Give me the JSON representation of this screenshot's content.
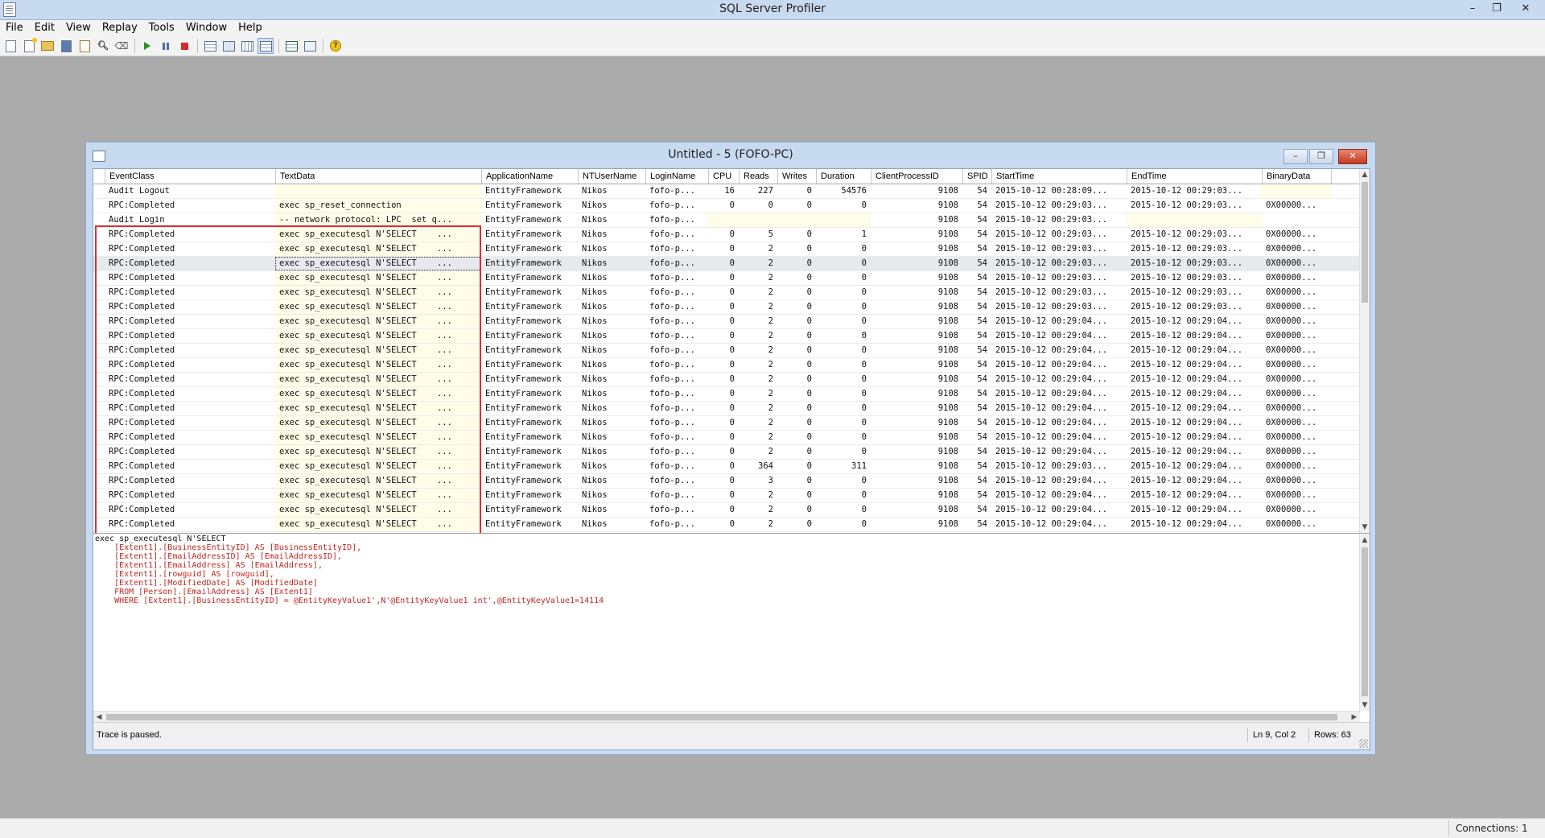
{
  "app": {
    "title": "SQL Server Profiler",
    "controls": {
      "minimize": "–",
      "restore": "❐",
      "close": "✕"
    }
  },
  "menu": [
    "File",
    "Edit",
    "View",
    "Replay",
    "Tools",
    "Window",
    "Help"
  ],
  "toolbar": {
    "icons": [
      "new-trace-icon",
      "new-template-icon",
      "open-icon",
      "save-icon",
      "properties-icon",
      "find-icon",
      "clear-icon",
      "start-icon",
      "pause-icon",
      "stop-icon",
      "sql-window-icon",
      "auto-scroll-icon",
      "columns-icon",
      "events-icon",
      "replay-icon",
      "monitor-icon",
      "help-icon"
    ]
  },
  "window": {
    "title": "Untitled - 5 (FOFO-PC)",
    "controls": {
      "minimize": "–",
      "restore": "❐",
      "close": "✕"
    }
  },
  "grid": {
    "columns": [
      "EventClass",
      "TextData",
      "ApplicationName",
      "NTUserName",
      "LoginName",
      "CPU",
      "Reads",
      "Writes",
      "Duration",
      "ClientProcessID",
      "SPID",
      "StartTime",
      "EndTime",
      "BinaryData"
    ],
    "rows": [
      [
        "Audit Logout",
        "",
        "EntityFramework",
        "Nikos",
        "fofo-p...",
        "16",
        "227",
        "0",
        "54576",
        "9108",
        "54",
        "2015-10-12 00:28:09...",
        "2015-10-12 00:29:03...",
        ""
      ],
      [
        "RPC:Completed",
        "exec sp_reset_connection",
        "EntityFramework",
        "Nikos",
        "fofo-p...",
        "0",
        "0",
        "0",
        "0",
        "9108",
        "54",
        "2015-10-12 00:29:03...",
        "2015-10-12 00:29:03...",
        "0X00000..."
      ],
      [
        "Audit Login",
        "-- network protocol: LPC  set q...",
        "EntityFramework",
        "Nikos",
        "fofo-p...",
        "",
        "",
        "",
        "",
        "9108",
        "54",
        "2015-10-12 00:29:03...",
        "",
        ""
      ],
      [
        "RPC:Completed",
        "exec sp_executesql N'SELECT    ...",
        "EntityFramework",
        "Nikos",
        "fofo-p...",
        "0",
        "5",
        "0",
        "1",
        "9108",
        "54",
        "2015-10-12 00:29:03...",
        "2015-10-12 00:29:03...",
        "0X00000..."
      ],
      [
        "RPC:Completed",
        "exec sp_executesql N'SELECT    ...",
        "EntityFramework",
        "Nikos",
        "fofo-p...",
        "0",
        "2",
        "0",
        "0",
        "9108",
        "54",
        "2015-10-12 00:29:03...",
        "2015-10-12 00:29:03...",
        "0X00000..."
      ],
      [
        "RPC:Completed",
        "exec sp_executesql N'SELECT    ...",
        "EntityFramework",
        "Nikos",
        "fofo-p...",
        "0",
        "2",
        "0",
        "0",
        "9108",
        "54",
        "2015-10-12 00:29:03...",
        "2015-10-12 00:29:03...",
        "0X00000..."
      ],
      [
        "RPC:Completed",
        "exec sp_executesql N'SELECT    ...",
        "EntityFramework",
        "Nikos",
        "fofo-p...",
        "0",
        "2",
        "0",
        "0",
        "9108",
        "54",
        "2015-10-12 00:29:03...",
        "2015-10-12 00:29:03...",
        "0X00000..."
      ],
      [
        "RPC:Completed",
        "exec sp_executesql N'SELECT    ...",
        "EntityFramework",
        "Nikos",
        "fofo-p...",
        "0",
        "2",
        "0",
        "0",
        "9108",
        "54",
        "2015-10-12 00:29:03...",
        "2015-10-12 00:29:03...",
        "0X00000..."
      ],
      [
        "RPC:Completed",
        "exec sp_executesql N'SELECT    ...",
        "EntityFramework",
        "Nikos",
        "fofo-p...",
        "0",
        "2",
        "0",
        "0",
        "9108",
        "54",
        "2015-10-12 00:29:03...",
        "2015-10-12 00:29:03...",
        "0X00000..."
      ],
      [
        "RPC:Completed",
        "exec sp_executesql N'SELECT    ...",
        "EntityFramework",
        "Nikos",
        "fofo-p...",
        "0",
        "2",
        "0",
        "0",
        "9108",
        "54",
        "2015-10-12 00:29:04...",
        "2015-10-12 00:29:04...",
        "0X00000..."
      ],
      [
        "RPC:Completed",
        "exec sp_executesql N'SELECT    ...",
        "EntityFramework",
        "Nikos",
        "fofo-p...",
        "0",
        "2",
        "0",
        "0",
        "9108",
        "54",
        "2015-10-12 00:29:04...",
        "2015-10-12 00:29:04...",
        "0X00000..."
      ],
      [
        "RPC:Completed",
        "exec sp_executesql N'SELECT    ...",
        "EntityFramework",
        "Nikos",
        "fofo-p...",
        "0",
        "2",
        "0",
        "0",
        "9108",
        "54",
        "2015-10-12 00:29:04...",
        "2015-10-12 00:29:04...",
        "0X00000..."
      ],
      [
        "RPC:Completed",
        "exec sp_executesql N'SELECT    ...",
        "EntityFramework",
        "Nikos",
        "fofo-p...",
        "0",
        "2",
        "0",
        "0",
        "9108",
        "54",
        "2015-10-12 00:29:04...",
        "2015-10-12 00:29:04...",
        "0X00000..."
      ],
      [
        "RPC:Completed",
        "exec sp_executesql N'SELECT    ...",
        "EntityFramework",
        "Nikos",
        "fofo-p...",
        "0",
        "2",
        "0",
        "0",
        "9108",
        "54",
        "2015-10-12 00:29:04...",
        "2015-10-12 00:29:04...",
        "0X00000..."
      ],
      [
        "RPC:Completed",
        "exec sp_executesql N'SELECT    ...",
        "EntityFramework",
        "Nikos",
        "fofo-p...",
        "0",
        "2",
        "0",
        "0",
        "9108",
        "54",
        "2015-10-12 00:29:04...",
        "2015-10-12 00:29:04...",
        "0X00000..."
      ],
      [
        "RPC:Completed",
        "exec sp_executesql N'SELECT    ...",
        "EntityFramework",
        "Nikos",
        "fofo-p...",
        "0",
        "2",
        "0",
        "0",
        "9108",
        "54",
        "2015-10-12 00:29:04...",
        "2015-10-12 00:29:04...",
        "0X00000..."
      ],
      [
        "RPC:Completed",
        "exec sp_executesql N'SELECT    ...",
        "EntityFramework",
        "Nikos",
        "fofo-p...",
        "0",
        "2",
        "0",
        "0",
        "9108",
        "54",
        "2015-10-12 00:29:04...",
        "2015-10-12 00:29:04...",
        "0X00000..."
      ],
      [
        "RPC:Completed",
        "exec sp_executesql N'SELECT    ...",
        "EntityFramework",
        "Nikos",
        "fofo-p...",
        "0",
        "2",
        "0",
        "0",
        "9108",
        "54",
        "2015-10-12 00:29:04...",
        "2015-10-12 00:29:04...",
        "0X00000..."
      ],
      [
        "RPC:Completed",
        "exec sp_executesql N'SELECT    ...",
        "EntityFramework",
        "Nikos",
        "fofo-p...",
        "0",
        "2",
        "0",
        "0",
        "9108",
        "54",
        "2015-10-12 00:29:04...",
        "2015-10-12 00:29:04...",
        "0X00000..."
      ],
      [
        "RPC:Completed",
        "exec sp_executesql N'SELECT    ...",
        "EntityFramework",
        "Nikos",
        "fofo-p...",
        "0",
        "364",
        "0",
        "311",
        "9108",
        "54",
        "2015-10-12 00:29:03...",
        "2015-10-12 00:29:04...",
        "0X00000..."
      ],
      [
        "RPC:Completed",
        "exec sp_executesql N'SELECT    ...",
        "EntityFramework",
        "Nikos",
        "fofo-p...",
        "0",
        "3",
        "0",
        "0",
        "9108",
        "54",
        "2015-10-12 00:29:04...",
        "2015-10-12 00:29:04...",
        "0X00000..."
      ],
      [
        "RPC:Completed",
        "exec sp_executesql N'SELECT    ...",
        "EntityFramework",
        "Nikos",
        "fofo-p...",
        "0",
        "2",
        "0",
        "0",
        "9108",
        "54",
        "2015-10-12 00:29:04...",
        "2015-10-12 00:29:04...",
        "0X00000..."
      ],
      [
        "RPC:Completed",
        "exec sp_executesql N'SELECT    ...",
        "EntityFramework",
        "Nikos",
        "fofo-p...",
        "0",
        "2",
        "0",
        "0",
        "9108",
        "54",
        "2015-10-12 00:29:04...",
        "2015-10-12 00:29:04...",
        "0X00000..."
      ],
      [
        "RPC:Completed",
        "exec sp_executesql N'SELECT    ...",
        "EntityFramework",
        "Nikos",
        "fofo-p...",
        "0",
        "2",
        "0",
        "0",
        "9108",
        "54",
        "2015-10-12 00:29:04...",
        "2015-10-12 00:29:04...",
        "0X00000..."
      ]
    ]
  },
  "text_pane": {
    "lines": [
      "exec sp_executesql N'SELECT",
      "    [Extent1].[BusinessEntityID] AS [BusinessEntityID],",
      "    [Extent1].[EmailAddressID] AS [EmailAddressID],",
      "    [Extent1].[EmailAddress] AS [EmailAddress],",
      "    [Extent1].[rowguid] AS [rowguid],",
      "    [Extent1].[ModifiedDate] AS [ModifiedDate]",
      "    FROM [Person].[EmailAddress] AS [Extent1]",
      "    WHERE [Extent1].[BusinessEntityID] = @EntityKeyValue1',N'@EntityKeyValue1 int',@EntityKeyValue1=14114"
    ]
  },
  "status": {
    "message": "Trace is paused.",
    "position": "Ln 9, Col 2",
    "rows": "Rows: 63"
  },
  "app_status": {
    "connections": "Connections: 1"
  },
  "colors": {
    "highlight_box": "#d9302c",
    "sql_text": "#c0261f",
    "textdata_bg": "#fffde8"
  }
}
